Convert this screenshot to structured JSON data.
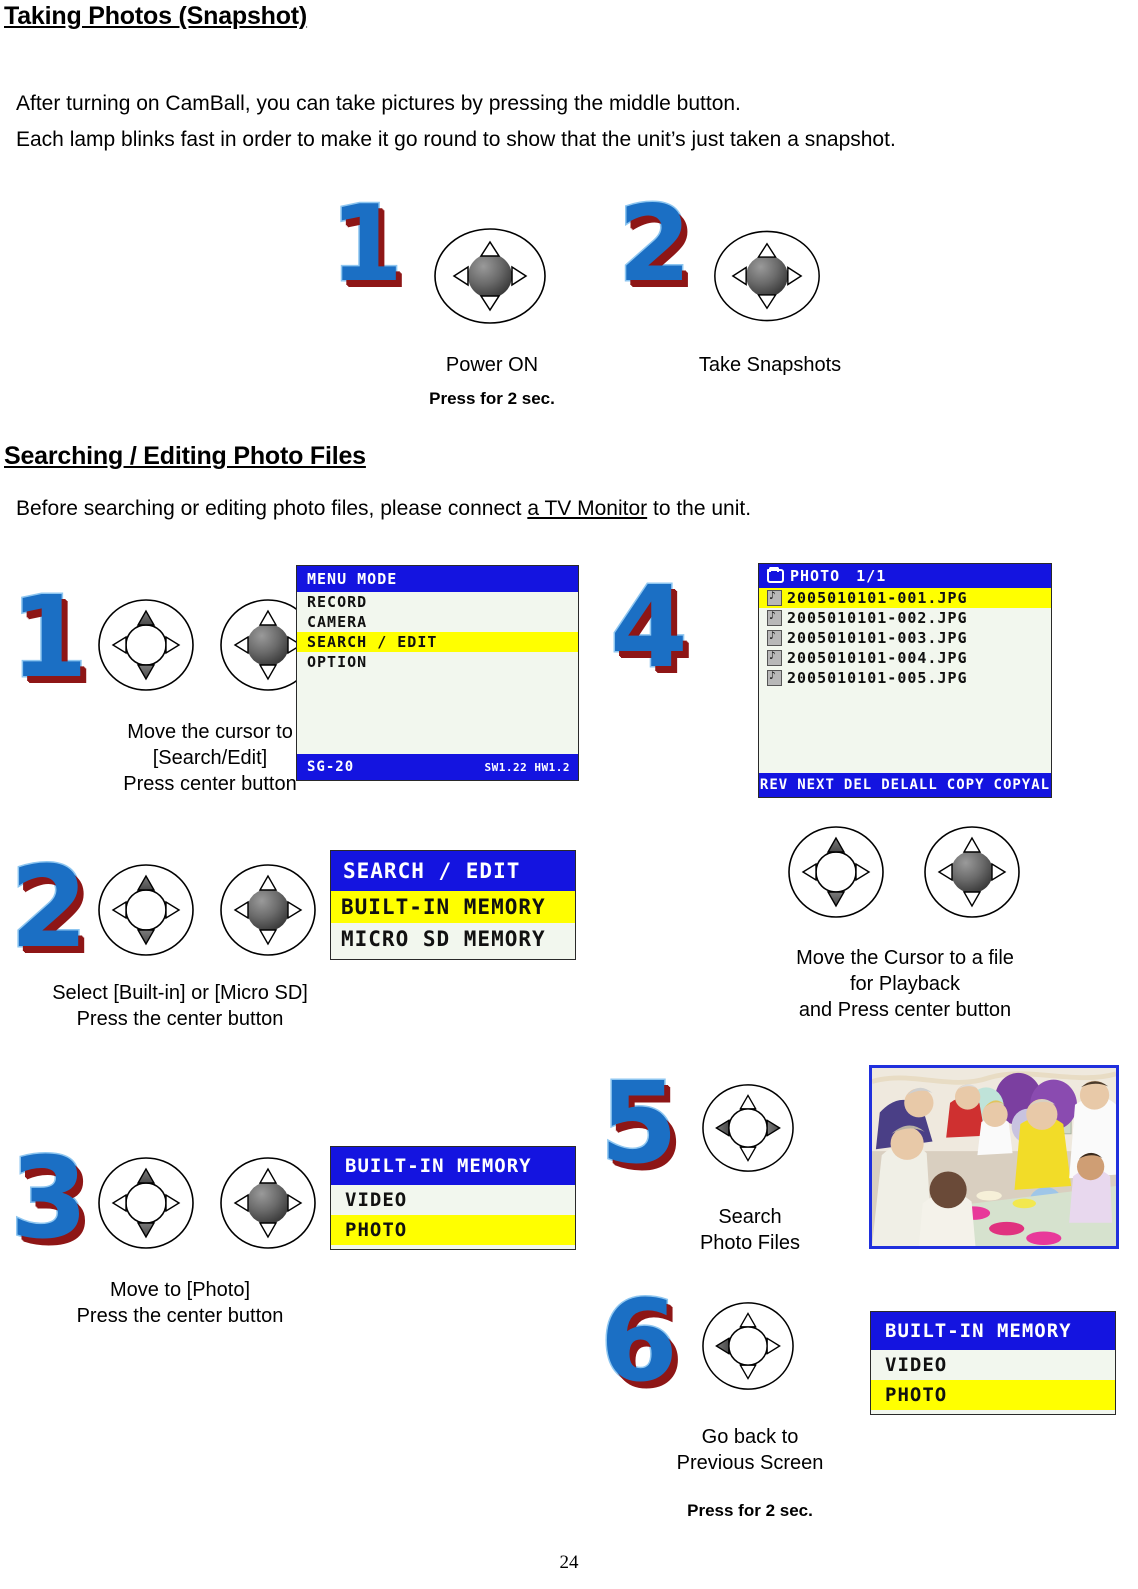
{
  "document": {
    "page_number": "24"
  },
  "sections": [
    {
      "id": "taking-photos",
      "title": "Taking Photos (Snapshot)",
      "paragraphs": [
        "After turning on CamBall, you can take pictures by pressing the middle button.",
        "Each lamp blinks fast in order to make it go round to show that the unit’s just taken a snapshot."
      ]
    },
    {
      "id": "searching-editing",
      "title": "Searching / Editing Photo Files",
      "intro_before": "Before searching or editing photo files, please connect ",
      "intro_underlined": "a TV Monitor",
      "intro_after": " to the unit."
    }
  ],
  "snapshot_steps": [
    {
      "numeral": "1",
      "caption_lines": [
        "Power ON"
      ],
      "note": "Press for 2 sec."
    },
    {
      "numeral": "2",
      "caption_lines": [
        "Take Snapshots"
      ],
      "note": ""
    }
  ],
  "search_steps": [
    {
      "numeral": "1",
      "caption_lines": [
        "Move the cursor to",
        "[Search/Edit]",
        "Press center button"
      ]
    },
    {
      "numeral": "2",
      "caption_lines": [
        "Select [Built-in] or [Micro SD]",
        "Press the center button"
      ]
    },
    {
      "numeral": "3",
      "caption_lines": [
        "Move to [Photo]",
        "Press the center button"
      ]
    },
    {
      "numeral": "4",
      "caption_lines": [
        "Move the Cursor to a file",
        "for Playback",
        "and Press center button"
      ]
    },
    {
      "numeral": "5",
      "caption_lines": [
        "Search",
        "Photo Files"
      ]
    },
    {
      "numeral": "6",
      "caption_lines": [
        "Go back to",
        "Previous Screen"
      ],
      "note": "Press for 2 sec."
    }
  ],
  "lcd_screens": {
    "menu_mode": {
      "title": "MENU MODE",
      "rows": [
        {
          "label": "RECORD",
          "highlighted": false
        },
        {
          "label": "CAMERA",
          "highlighted": false
        },
        {
          "label": "SEARCH / EDIT",
          "highlighted": true
        },
        {
          "label": "OPTION",
          "highlighted": false
        }
      ],
      "footer_model": "SG-20",
      "footer_version": "SW1.22 HW1.2"
    },
    "search_edit": {
      "title": "SEARCH / EDIT",
      "rows": [
        {
          "label": "BUILT-IN MEMORY",
          "highlighted": true
        },
        {
          "label": "MICRO SD MEMORY",
          "highlighted": false
        }
      ]
    },
    "built_in_memory": {
      "title": "BUILT-IN MEMORY",
      "rows": [
        {
          "label": "VIDEO",
          "highlighted": false
        },
        {
          "label": "PHOTO",
          "highlighted": true
        }
      ]
    },
    "photo_list": {
      "title": "PHOTO",
      "page_indicator": "1/1",
      "files": [
        {
          "name": "2005010101-001.JPG",
          "highlighted": true
        },
        {
          "name": "2005010101-002.JPG",
          "highlighted": false
        },
        {
          "name": "2005010101-003.JPG",
          "highlighted": false
        },
        {
          "name": "2005010101-004.JPG",
          "highlighted": false
        },
        {
          "name": "2005010101-005.JPG",
          "highlighted": false
        }
      ],
      "footer_actions": [
        "PREV",
        "NEXT",
        "DEL",
        "DELALL",
        "COPY",
        "COPYALL"
      ]
    }
  },
  "colors": {
    "lcd_header_blue": "#1414e0",
    "lcd_highlight_yellow": "#ffff00",
    "lcd_background": "#f2f7ee",
    "numeral_blue": "#1b6fc4",
    "numeral_light_blue": "#8ec6f0",
    "numeral_dark_red": "#8e1616",
    "photo_border_blue": "#2030dd"
  }
}
